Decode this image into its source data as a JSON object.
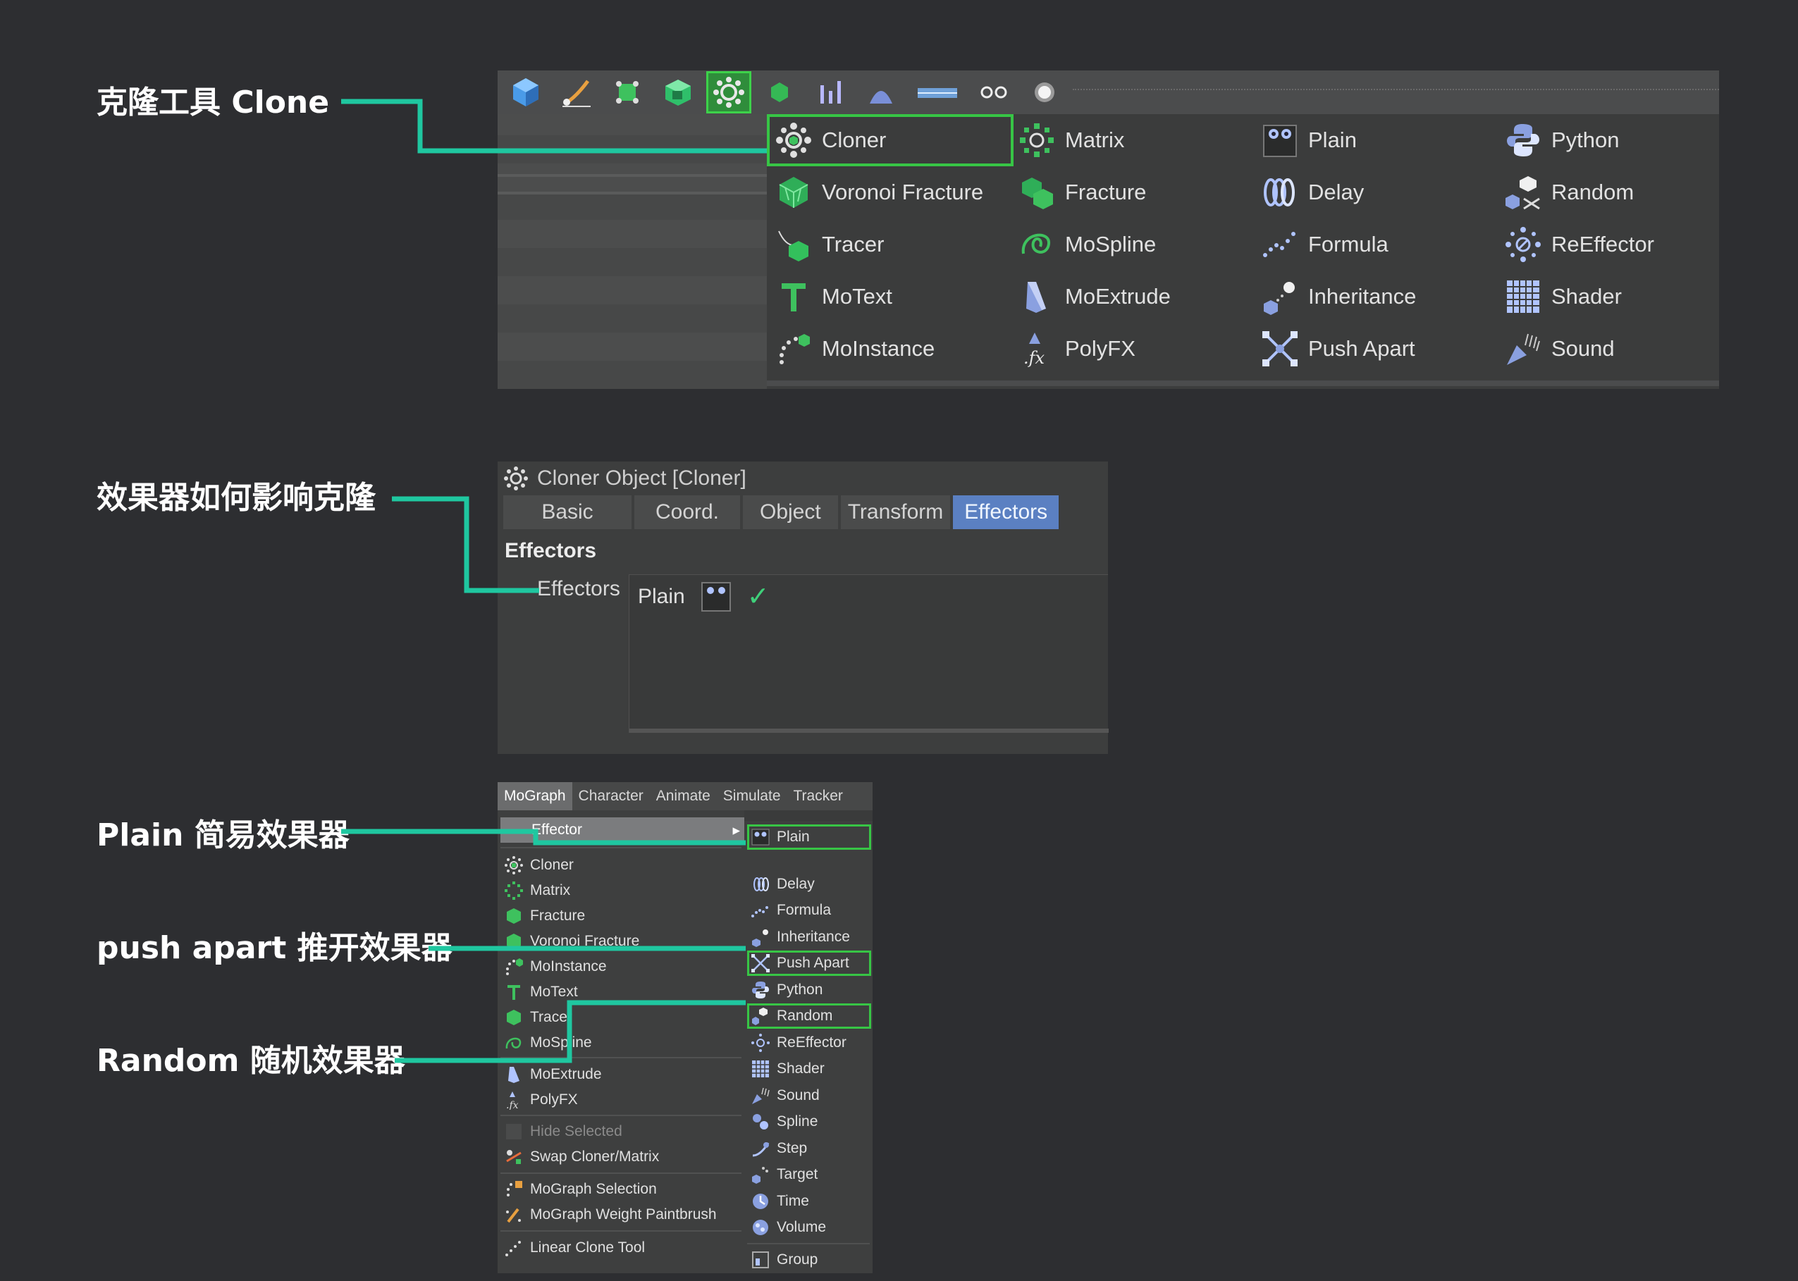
{
  "annotations": {
    "clone": "克隆工具 Clone",
    "effectors_how": "效果器如何影响克隆",
    "plain": "Plain 简易效果器",
    "push_apart": "push apart 推开效果器",
    "random": "Random 随机效果器"
  },
  "accent_colors": {
    "line": "#1fc7a0",
    "highlight": "#37c545",
    "tab_active": "#5b80c2"
  },
  "toolbar": {
    "icons": [
      "cube-icon",
      "pen-icon",
      "spline-cube-icon",
      "box-icon",
      "cloner-icon",
      "small-cube-icon",
      "bars-icon",
      "deformer-icon",
      "grid-icon",
      "glasses-icon",
      "light-icon"
    ]
  },
  "mograph_dropdown": {
    "col1": [
      "Cloner",
      "Voronoi Fracture",
      "Tracer",
      "MoText",
      "MoInstance"
    ],
    "col2": [
      "Matrix",
      "Fracture",
      "MoSpline",
      "MoExtrude",
      "PolyFX"
    ],
    "col3": [
      "Plain",
      "Delay",
      "Formula",
      "Inheritance",
      "Push Apart"
    ],
    "col4": [
      "Python",
      "Random",
      "ReEffector",
      "Shader",
      "Sound"
    ]
  },
  "cloner_panel": {
    "title": "Cloner Object [Cloner]",
    "tabs": [
      "Basic",
      "Coord.",
      "Object",
      "Transform",
      "Effectors"
    ],
    "section": "Effectors",
    "field_label": "Effectors",
    "entry": "Plain",
    "check": "✓"
  },
  "mograph_menu": {
    "menubar": [
      "MoGraph",
      "Character",
      "Animate",
      "Simulate",
      "Tracker"
    ],
    "submenu_label": "Effector",
    "submenu_arrow": "▸",
    "left_group1": [
      "Cloner",
      "Matrix",
      "Fracture",
      "Voronoi Fracture",
      "MoInstance",
      "MoText",
      "Tracer",
      "MoSpline"
    ],
    "left_group2": [
      "MoExtrude",
      "PolyFX"
    ],
    "left_group3": [
      "Hide Selected",
      "Swap Cloner/Matrix"
    ],
    "left_group4": [
      "MoGraph Selection",
      "MoGraph Weight Paintbrush"
    ],
    "left_group5": [
      "Linear Clone Tool"
    ],
    "right": [
      "Plain",
      "Delay",
      "Formula",
      "Inheritance",
      "Push Apart",
      "Python",
      "Random",
      "ReEffector",
      "Shader",
      "Sound",
      "Spline",
      "Step",
      "Target",
      "Time",
      "Volume"
    ],
    "right_group2": [
      "Group"
    ]
  }
}
